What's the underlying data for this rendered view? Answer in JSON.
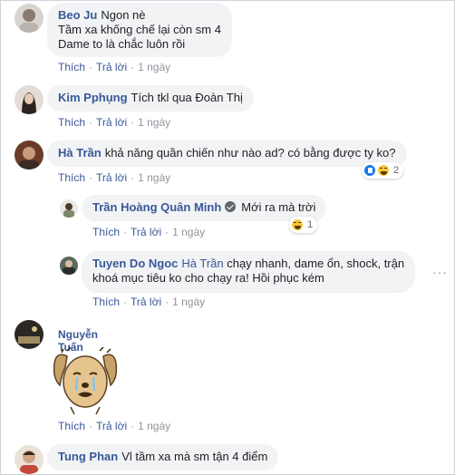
{
  "actions": {
    "like": "Thích",
    "reply": "Trả lời",
    "separator": "·"
  },
  "comments": [
    {
      "author": "Beo Ju",
      "text_lines": [
        "Ngon nè",
        "Tầm xa khống chế lại còn sm 4",
        "Dame to là chắc luôn rồi"
      ],
      "time": "1 ngày"
    },
    {
      "author": "Kim Pphụng",
      "text": "Tích tkl qua Đoàn Thị",
      "time": "1 ngày"
    },
    {
      "author": "Hà Trần",
      "text": "khả năng quần chiến như nào ad? có bằng được ty ko?",
      "time": "1 ngày",
      "reaction_count": "2"
    },
    {
      "author": "Trần Hoàng Quân Minh",
      "text": "Mới ra mà trời",
      "time": "1 ngày",
      "reaction_count": "1",
      "verified": true
    },
    {
      "author": "Tuyen Do Ngoc",
      "mention": "Hà Trần",
      "text_line1": "chạy nhanh, dame ổn, shock, trận",
      "text_line2": "khoá mục tiêu ko cho chạy ra! Hồi phục kém",
      "time": "1 ngày",
      "more": "···"
    },
    {
      "author": "Nguyễn Tuấn",
      "time": "1 ngày",
      "sticker": "crying-dog-sticker"
    },
    {
      "author": "Tung Phan",
      "text": "Vl tầm xa mà sm tận 4 điểm"
    }
  ],
  "colors": {
    "link": "#385898",
    "bubble": "#f2f3f5",
    "meta": "#90949c",
    "like": "#1877f2",
    "haha": "#f7c73b"
  }
}
